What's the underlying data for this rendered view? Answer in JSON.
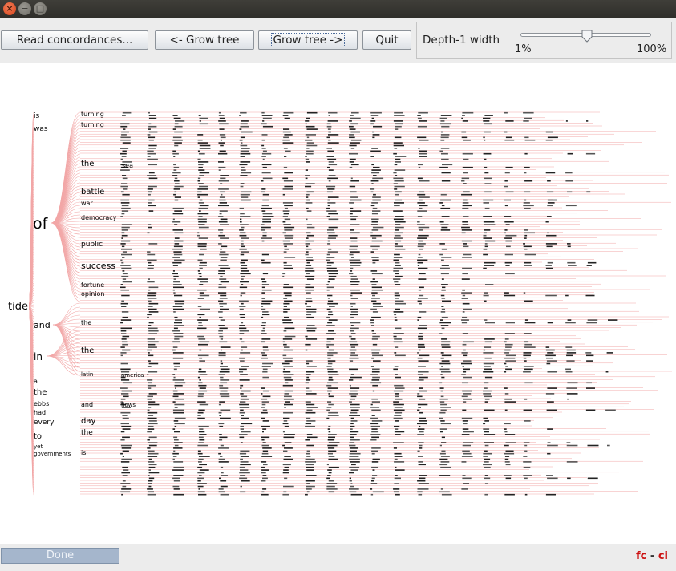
{
  "window": {
    "controls": {
      "close": "×",
      "minimize": "−",
      "maximize": "□"
    }
  },
  "toolbar": {
    "read_label": "Read concordances...",
    "prev_label": "<- Grow tree",
    "next_label": "Grow tree ->",
    "quit_label": "Quit",
    "slider": {
      "label": "Depth-1 width",
      "min_label": "1%",
      "max_label": "100%",
      "value": 0.55
    }
  },
  "tree": {
    "root": "tide",
    "level1": [
      "is",
      "was",
      "of",
      "and",
      "in",
      "a",
      "the",
      "ebbs",
      "had",
      "every",
      "to",
      "yet",
      "governments"
    ],
    "level2": [
      "turning",
      "turning",
      "the",
      "battle",
      "war",
      "democracy",
      "public",
      "success",
      "fortune",
      "opinion",
      "the",
      "the",
      "latin",
      "and",
      "day",
      "the",
      "is"
    ],
    "level3": [
      "sea",
      "america",
      "flows"
    ]
  },
  "status": {
    "progress_label": "Done",
    "brand_left": "fc",
    "brand_sep": "-",
    "brand_right": "ci"
  },
  "colors": {
    "edge": "#f2a7a7",
    "brand": "#cc1111",
    "progress": "#a5b6cc"
  }
}
